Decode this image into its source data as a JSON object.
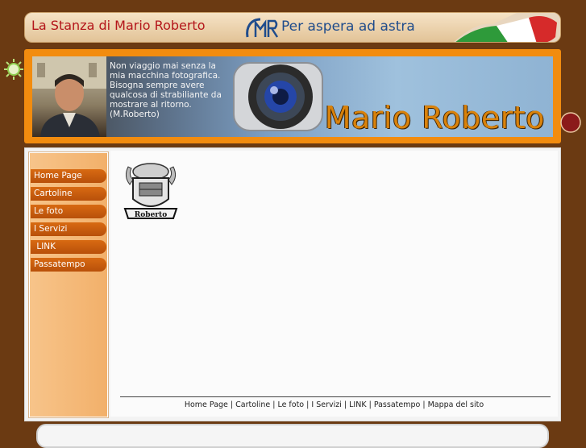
{
  "header": {
    "site_title": "La Stanza di Mario Roberto",
    "motto": "Per aspera ad astra",
    "logo_initials": "MR"
  },
  "banner": {
    "quote_lines": [
      "Non viaggio mai senza la",
      "mia macchina fotografica.",
      "Bisogna sempre avere",
      "qualcosa di strabiliante da",
      "mostrare al ritorno."
    ],
    "quote_author": "(M.Roberto)",
    "name": "Mario Roberto"
  },
  "sidebar": {
    "items": [
      {
        "label": "Home Page"
      },
      {
        "label": "Cartoline"
      },
      {
        "label": "Le foto"
      },
      {
        "label": "I Servizi"
      },
      {
        "label": " LINK"
      },
      {
        "label": "Passatempo"
      }
    ]
  },
  "content": {
    "crest_label": "Roberto"
  },
  "footer": {
    "links": [
      "Home Page",
      "Cartoline",
      "Le foto",
      "I Servizi",
      "LINK",
      "Passatempo",
      "Mappa del sito"
    ],
    "separator": " | "
  },
  "colors": {
    "background": "#6b3a12",
    "accent_orange": "#f28c0f",
    "title_red": "#b4161b",
    "motto_blue": "#1f4c8c",
    "nav_button": "#c75d0e"
  }
}
